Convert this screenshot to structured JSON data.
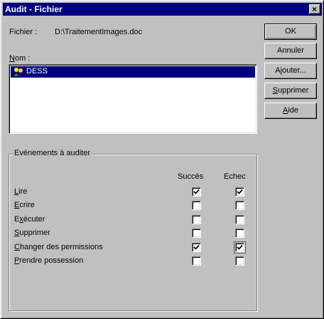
{
  "window": {
    "title": "Audit - Fichier"
  },
  "file": {
    "label": "Fichier :",
    "value": "D:\\TraitementImages.doc"
  },
  "names": {
    "label": "Nom :",
    "items": [
      {
        "label": "DESS",
        "selected": true,
        "icon": "group-icon"
      }
    ]
  },
  "buttons": {
    "ok": "OK",
    "cancel": "Annuler",
    "add": "Ajouter...",
    "remove": "Supprimer",
    "help": "Aide"
  },
  "events": {
    "group_label": "Evénements à auditer",
    "col_success": "Succès",
    "col_failure": "Echec",
    "rows": [
      {
        "label": "Lire",
        "success": true,
        "failure": true
      },
      {
        "label": "Ecrire",
        "success": false,
        "failure": false
      },
      {
        "label": "Exécuter",
        "success": false,
        "failure": false
      },
      {
        "label": "Supprimer",
        "success": false,
        "failure": false
      },
      {
        "label": "Changer des permissions",
        "success": true,
        "failure": true
      },
      {
        "label": "Prendre possession",
        "success": false,
        "failure": false
      }
    ]
  },
  "colors": {
    "title_bar": "#000080",
    "selection": "#000080",
    "face": "#c0c0c0"
  }
}
